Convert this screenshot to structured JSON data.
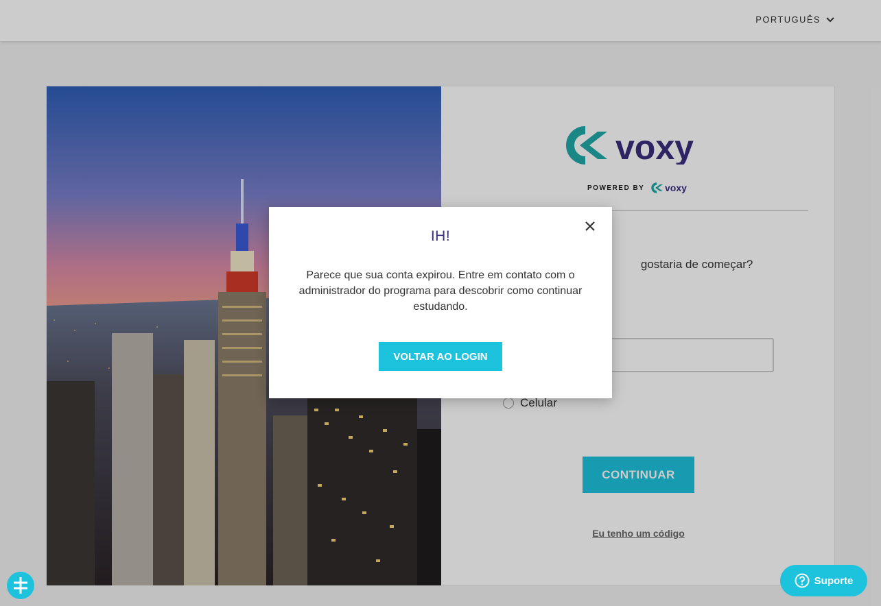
{
  "header": {
    "language": "PORTUGUÊS"
  },
  "login": {
    "brand": "voxy",
    "powered_by": "POWERED BY",
    "powered_brand": "voxy",
    "question_partial": "gostaria de começar?",
    "radio_option": "Celular",
    "continue_label": "CONTINUAR",
    "code_link": "Eu tenho um código"
  },
  "modal": {
    "title": "IH!",
    "message": "Parece que sua conta expirou. Entre em contato com o administrador do programa para descobrir como continuar estudando.",
    "button_label": "VOLTAR AO LOGIN"
  },
  "support": {
    "label": "Suporte"
  },
  "colors": {
    "accent": "#1dc2dc",
    "brand_teal": "#22a8a8",
    "brand_purple": "#3a2e7d"
  },
  "icons": {
    "close": "close-icon",
    "language_toggle": "chevron-down-icon",
    "support": "help-icon",
    "chat": "chat-bubble-icon"
  }
}
